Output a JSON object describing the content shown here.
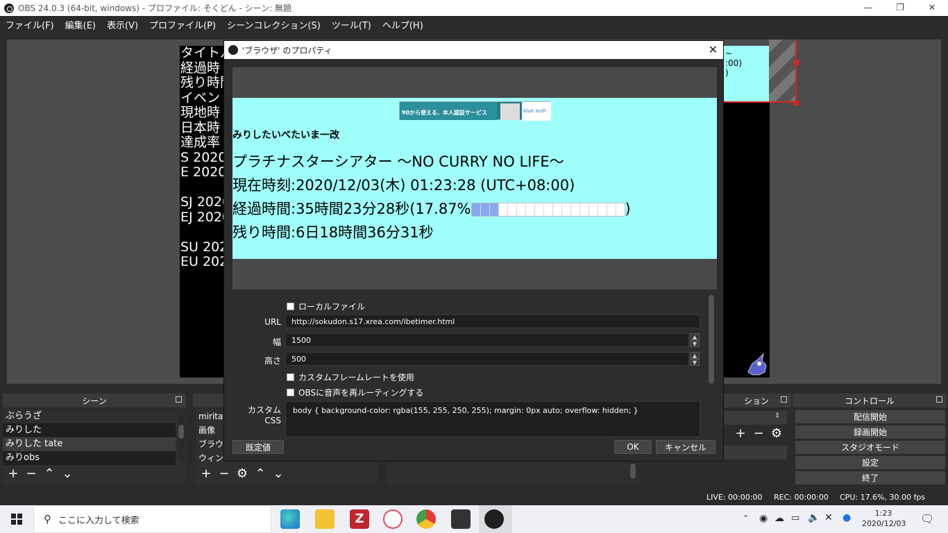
{
  "window": {
    "title": "OBS 24.0.3 (64-bit, windows) - プロファイル: そくどん - シーン: 無題",
    "minimize": "—",
    "maximize": "❐",
    "close": "✕"
  },
  "menu": [
    "ファイル(F)",
    "編集(E)",
    "表示(V)",
    "プロファイル(P)",
    "シーンコレクション(S)",
    "ツール(T)",
    "ヘルプ(H)"
  ],
  "preview": {
    "overlay_lines": "タイトル\n経過時\n残り時間\nイベント\n現地時\n日本時\n達成率\nS 2020-\nE 2020-\n\nSJ 2020\nEJ 2020\n\nSU 2020\nEU 2020",
    "cyan_text": "~\n:00)\n)"
  },
  "dialog": {
    "title": "'ブラウザ' のプロパティ",
    "close": "✕",
    "web": {
      "banner_text": "¥0から使える、本人認証サービス",
      "banner_brand": "blue auth",
      "subtitle": "みりしたいべたいま一改",
      "line1": "プラチナスターシアター ～NO CURRY NO LIFE～",
      "line2": "現在時刻:2020/12/03(木) 01:23:28 (UTC+08:00)",
      "line3_prefix": "経過時間:35時間23分28秒(17.87%",
      "line3_suffix": ")",
      "line4": "残り時間:6日18時間36分31秒",
      "progress_fraction": 0.1787
    },
    "local_file_label": "ローカルファイル",
    "url_label": "URL",
    "url_value": "http://sokudon.s17.xrea.com/ibetimer.html",
    "width_label": "幅",
    "width_value": "1500",
    "height_label": "高さ",
    "height_value": "500",
    "custom_fps_label": "カスタムフレームレートを使用",
    "reroute_audio_label": "OBSに音声を再ルーティングする",
    "css_label": "カスタム CSS",
    "css_value": "body { background-color: rgba(155, 255, 250, 255); margin: 0px auto; overflow: hidden; }",
    "defaults_btn": "既定値",
    "ok_btn": "OK",
    "cancel_btn": "キャンセル"
  },
  "scenes": {
    "title": "シーン",
    "items": [
      "ぶらうざ",
      "みりした",
      "みりした tate",
      "みりobs"
    ]
  },
  "sources": {
    "items": [
      "miritate",
      "画像",
      "ブラウザ",
      "ウィンドウ"
    ]
  },
  "transitions_title": "ション",
  "controls": {
    "title": "コントロール",
    "buttons": [
      "配信開始",
      "録画開始",
      "スタジオモード",
      "設定",
      "終了"
    ]
  },
  "status": {
    "live": "LIVE: 00:00:00",
    "rec": "REC: 00:00:00",
    "cpu": "CPU: 17.6%, 30.00 fps"
  },
  "taskbar": {
    "search_placeholder": "ここに入力して検索",
    "time": "1:23",
    "date": "2020/12/03"
  },
  "colors": {
    "web_bg": "#9ffffa",
    "selection_red": "#e02020",
    "progress_fill": "#86a8ee"
  }
}
